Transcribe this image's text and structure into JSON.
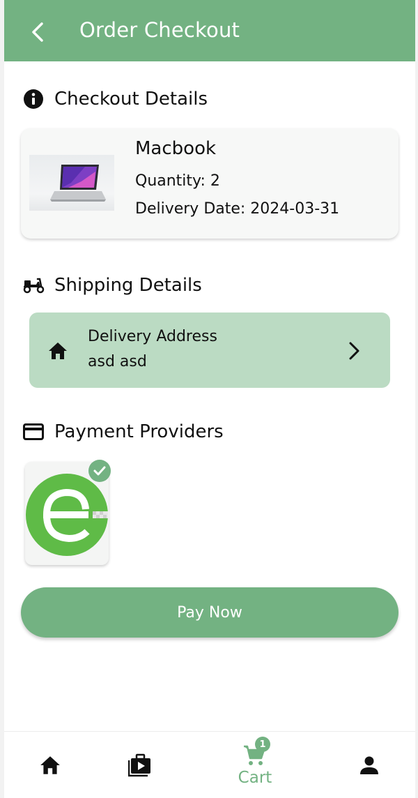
{
  "appbar": {
    "title": "Order Checkout"
  },
  "checkout": {
    "heading": "Checkout Details",
    "product": {
      "name": "Macbook",
      "quantity": "Quantity: 2",
      "delivery_date": "Delivery Date: 2024-03-31"
    }
  },
  "shipping": {
    "heading": "Shipping Details",
    "address_label": "Delivery Address",
    "address_value": "asd asd"
  },
  "payment": {
    "heading": "Payment Providers",
    "selected_provider_icon": "esewa-logo"
  },
  "pay_button": {
    "label": "Pay Now"
  },
  "bottom_nav": {
    "cart_label": "Cart",
    "cart_count": "1"
  },
  "colors": {
    "primary": "#73b282",
    "address_card": "#bbdbc3",
    "logo_green": "#5fbb47"
  }
}
